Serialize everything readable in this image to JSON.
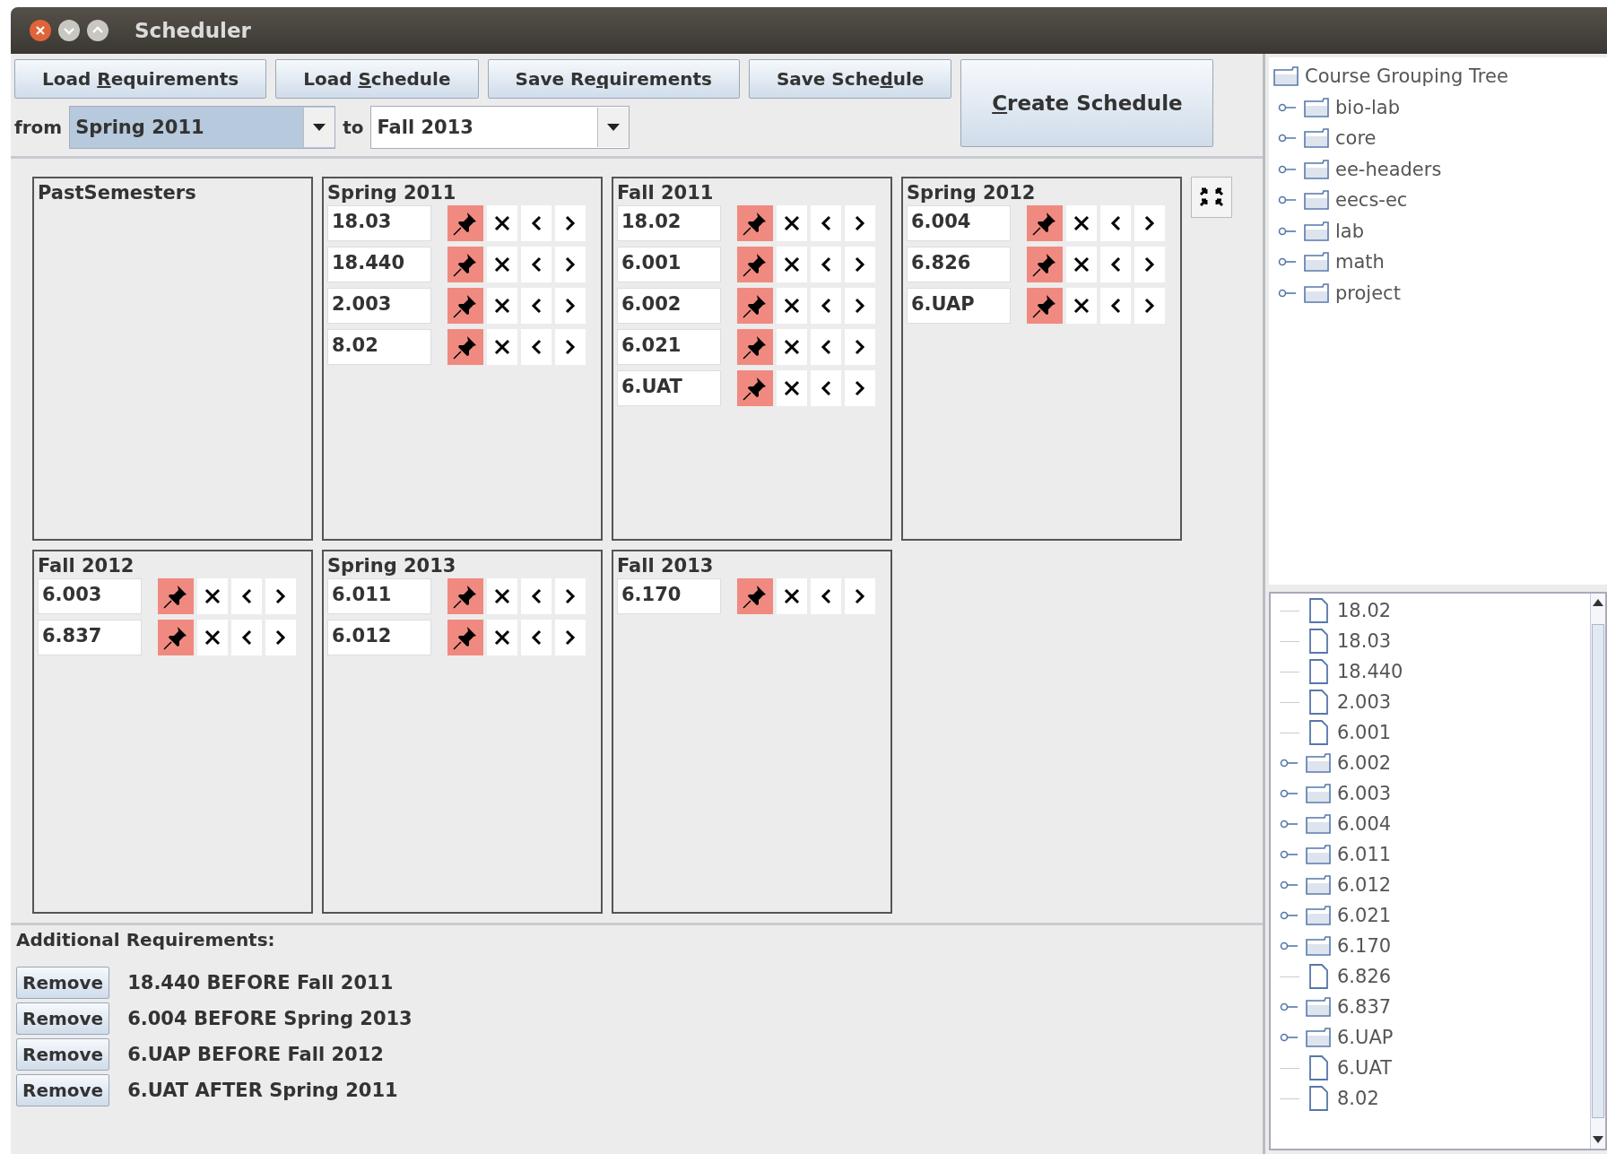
{
  "window": {
    "title": "Scheduler"
  },
  "toolbar": {
    "buttons": [
      {
        "pre": "Load ",
        "key": "R",
        "post": "equirements"
      },
      {
        "pre": "Load ",
        "key": "S",
        "post": "chedule"
      },
      {
        "pre": "Save Re",
        "key": "q",
        "post": "uirements"
      },
      {
        "pre": "Save Sche",
        "key": "d",
        "post": "ule"
      }
    ],
    "create_button": {
      "key": "C",
      "post": "reate Schedule"
    },
    "from_label": "from",
    "from_value": "Spring 2011",
    "to_label": "to",
    "to_value": "Fall 2013"
  },
  "semesters": [
    {
      "title": "PastSemesters"
    },
    {
      "title": "Spring 2011",
      "courses": [
        {
          "code": "18.03",
          "pinned": true
        },
        {
          "code": "18.440",
          "pinned": true
        },
        {
          "code": "2.003",
          "pinned": true
        },
        {
          "code": "8.02",
          "pinned": true
        }
      ]
    },
    {
      "title": "Fall 2011",
      "courses": [
        {
          "code": "18.02",
          "pinned": true
        },
        {
          "code": "6.001",
          "pinned": true
        },
        {
          "code": "6.002",
          "pinned": true
        },
        {
          "code": "6.021",
          "pinned": true
        },
        {
          "code": "6.UAT",
          "pinned": true
        }
      ]
    },
    {
      "title": "Spring 2012",
      "courses": [
        {
          "code": "6.004",
          "pinned": true
        },
        {
          "code": "6.826",
          "pinned": true
        },
        {
          "code": "6.UAP",
          "pinned": true
        }
      ]
    },
    {
      "title": "Fall 2012",
      "courses": [
        {
          "code": "6.003",
          "pinned": true
        },
        {
          "code": "6.837",
          "pinned": true
        }
      ]
    },
    {
      "title": "Spring 2013",
      "courses": [
        {
          "code": "6.011",
          "pinned": true
        },
        {
          "code": "6.012",
          "pinned": true
        }
      ]
    },
    {
      "title": "Fall 2013",
      "courses": [
        {
          "code": "6.170",
          "pinned": true
        }
      ]
    }
  ],
  "additional_requirements": {
    "title": "Additional Requirements:",
    "items": [
      {
        "button": "Remove",
        "text": "18.440 BEFORE Fall 2011"
      },
      {
        "button": "Remove",
        "text": "6.004 BEFORE Spring 2013"
      },
      {
        "button": "Remove",
        "text": "6.UAP BEFORE Fall 2012"
      },
      {
        "button": "Remove",
        "text": "6.UAT AFTER Spring 2011"
      }
    ]
  },
  "grouping_tree": {
    "root": "Course Grouping Tree",
    "children": [
      {
        "label": "bio-lab",
        "expanded": false
      },
      {
        "label": "core",
        "expanded": false
      },
      {
        "label": "ee-headers",
        "expanded": false
      },
      {
        "label": "eecs-ec",
        "expanded": false
      },
      {
        "label": "lab",
        "expanded": false
      },
      {
        "label": "math",
        "expanded": false
      },
      {
        "label": "project",
        "expanded": false
      }
    ]
  },
  "course_list": [
    {
      "label": "18.02",
      "kind": "leaf"
    },
    {
      "label": "18.03",
      "kind": "leaf"
    },
    {
      "label": "18.440",
      "kind": "leaf"
    },
    {
      "label": "2.003",
      "kind": "leaf"
    },
    {
      "label": "6.001",
      "kind": "leaf"
    },
    {
      "label": "6.002",
      "kind": "folder"
    },
    {
      "label": "6.003",
      "kind": "folder"
    },
    {
      "label": "6.004",
      "kind": "folder"
    },
    {
      "label": "6.011",
      "kind": "folder"
    },
    {
      "label": "6.012",
      "kind": "folder"
    },
    {
      "label": "6.021",
      "kind": "folder"
    },
    {
      "label": "6.170",
      "kind": "folder"
    },
    {
      "label": "6.826",
      "kind": "leaf"
    },
    {
      "label": "6.837",
      "kind": "folder"
    },
    {
      "label": "6.UAP",
      "kind": "folder"
    },
    {
      "label": "6.UAT",
      "kind": "leaf"
    },
    {
      "label": "8.02",
      "kind": "leaf"
    }
  ]
}
